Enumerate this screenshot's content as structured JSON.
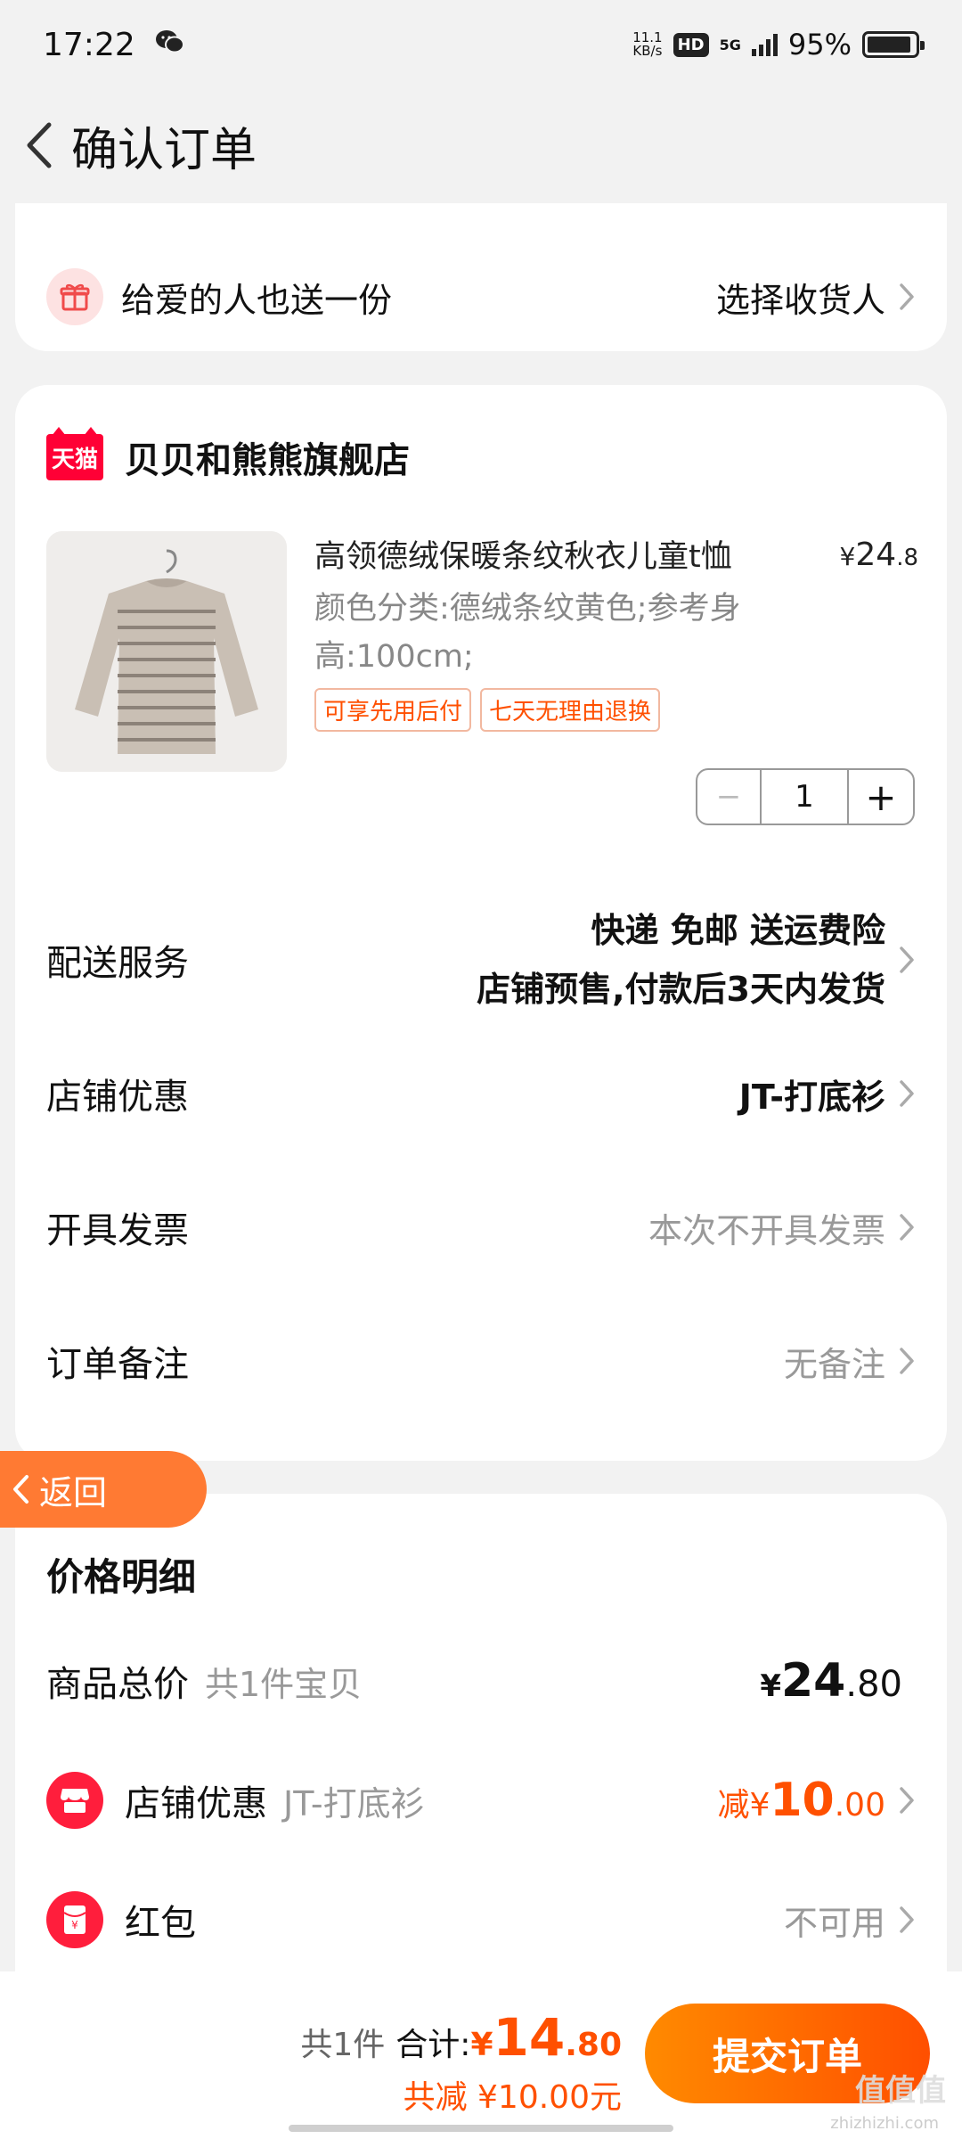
{
  "status_bar": {
    "time": "17:22",
    "net_speed_value": "11.1",
    "net_speed_unit": "KB/s",
    "hd": "HD",
    "network": "5G",
    "battery": "95%"
  },
  "nav": {
    "title": "确认订单"
  },
  "gift": {
    "text": "给爱的人也送一份",
    "action": "选择收货人"
  },
  "shop": {
    "badge": "天猫",
    "name": "贝贝和熊熊旗舰店",
    "product": {
      "title": "高领德绒保暖条纹秋衣儿童t恤",
      "price_symbol": "¥",
      "price_int": "24",
      "price_dec": ".8",
      "sku": "颜色分类:德绒条纹黄色;参考身高:100cm;",
      "tags": [
        "可享先用后付",
        "七天无理由退换"
      ],
      "quantity": "1"
    },
    "delivery": {
      "label": "配送服务",
      "line1": "快递 免邮 送运费险",
      "line2": "店铺预售,付款后3天内发货"
    },
    "shop_discount": {
      "label": "店铺优惠",
      "value": "JT-打底衫"
    },
    "invoice": {
      "label": "开具发票",
      "value": "本次不开具发票"
    },
    "note": {
      "label": "订单备注",
      "value": "无备注"
    }
  },
  "float_back": {
    "label": "返回"
  },
  "price_detail": {
    "title": "价格明细",
    "total": {
      "label": "商品总价",
      "sub": "共1件宝贝",
      "symbol": "¥",
      "int": "24",
      "dec": ".80"
    },
    "shop_discount": {
      "label": "店铺优惠",
      "sub": "JT-打底衫",
      "prefix": "减",
      "symbol": "¥",
      "int": "10",
      "dec": ".00"
    },
    "red_packet": {
      "label": "红包",
      "value": "不可用"
    }
  },
  "bottom": {
    "count": "共1件",
    "total_label": "合计:",
    "symbol": "¥",
    "int": "14",
    "dec": ".80",
    "saved": "共减 ¥10.00元",
    "submit": "提交订单"
  },
  "watermark": {
    "main": "值值值",
    "sub": "zhizhizhi.com"
  },
  "colors": {
    "accent": "#ff5000",
    "tmall_red": "#ff0036",
    "float_back": "#ff7a33",
    "background": "#f2f2f2"
  }
}
